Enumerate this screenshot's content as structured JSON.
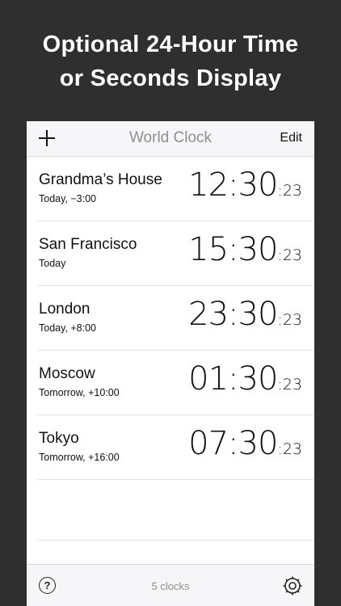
{
  "promo": {
    "line1": "Optional 24-Hour Time",
    "line2": "or Seconds Display"
  },
  "navbar": {
    "title": "World Clock",
    "edit_label": "Edit",
    "add_icon": "plus-icon"
  },
  "clocks": [
    {
      "city": "Grandma’s House",
      "offset": "Today, −3:00",
      "time": "12:30",
      "seconds": ":23"
    },
    {
      "city": "San Francisco",
      "offset": "Today",
      "time": "15:30",
      "seconds": ":23"
    },
    {
      "city": "London",
      "offset": "Today, +8:00",
      "time": "23:30",
      "seconds": ":23"
    },
    {
      "city": "Moscow",
      "offset": "Tomorrow, +10:00",
      "time": "01:30",
      "seconds": ":23"
    },
    {
      "city": "Tokyo",
      "offset": "Tomorrow, +16:00",
      "time": "07:30",
      "seconds": ":23"
    }
  ],
  "toolbar": {
    "help_icon": "help-icon",
    "help_glyph": "?",
    "count_label": "5 clocks",
    "settings_icon": "gear-icon"
  },
  "colors": {
    "background": "#2f2f2f",
    "bar": "#f6f6f8",
    "muted_text": "#8e8e93"
  }
}
